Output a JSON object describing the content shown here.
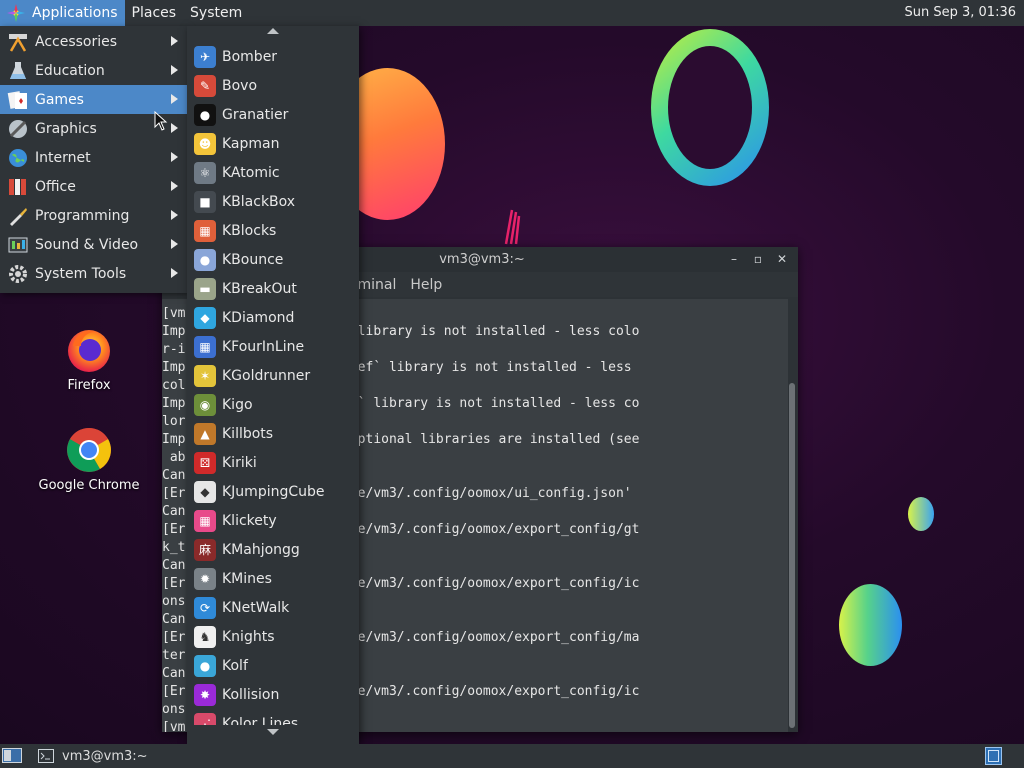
{
  "top_panel": {
    "menus": [
      {
        "label": "Applications",
        "icon": "applications-menu-icon",
        "active": true
      },
      {
        "label": "Places"
      },
      {
        "label": "System"
      }
    ],
    "clock": "Sun Sep  3, 01:36"
  },
  "desktop": {
    "icons": [
      {
        "label": "Firefox",
        "icon": "firefox-icon"
      },
      {
        "label": "Google Chrome",
        "icon": "chrome-icon"
      }
    ]
  },
  "apps_menu": {
    "categories": [
      {
        "label": "Accessories",
        "icon": "accessories-icon"
      },
      {
        "label": "Education",
        "icon": "education-icon"
      },
      {
        "label": "Games",
        "icon": "games-icon",
        "active": true
      },
      {
        "label": "Graphics",
        "icon": "graphics-icon"
      },
      {
        "label": "Internet",
        "icon": "internet-icon"
      },
      {
        "label": "Office",
        "icon": "office-icon"
      },
      {
        "label": "Programming",
        "icon": "programming-icon"
      },
      {
        "label": "Sound & Video",
        "icon": "sound-video-icon"
      },
      {
        "label": "System Tools",
        "icon": "system-tools-icon"
      }
    ]
  },
  "games_menu": {
    "items": [
      {
        "label": "Bomber",
        "color": "#3c7fd0",
        "glyph": "✈"
      },
      {
        "label": "Bovo",
        "color": "#d64a3a",
        "glyph": "✎"
      },
      {
        "label": "Granatier",
        "color": "#111111",
        "glyph": "●"
      },
      {
        "label": "Kapman",
        "color": "#f3c43a",
        "glyph": "☻"
      },
      {
        "label": "KAtomic",
        "color": "#6f7a85",
        "glyph": "⚛"
      },
      {
        "label": "KBlackBox",
        "color": "#444a50",
        "glyph": "■"
      },
      {
        "label": "KBlocks",
        "color": "#e0603a",
        "glyph": "▦"
      },
      {
        "label": "KBounce",
        "color": "#8aa6d8",
        "glyph": "●"
      },
      {
        "label": "KBreakOut",
        "color": "#9aa48a",
        "glyph": "▬"
      },
      {
        "label": "KDiamond",
        "color": "#2fa6e0",
        "glyph": "◆"
      },
      {
        "label": "KFourInLine",
        "color": "#3c6fd0",
        "glyph": "▦"
      },
      {
        "label": "KGoldrunner",
        "color": "#e3c43a",
        "glyph": "✶"
      },
      {
        "label": "Kigo",
        "color": "#6d8f3a",
        "glyph": "◉"
      },
      {
        "label": "Killbots",
        "color": "#c0782a",
        "glyph": "▲"
      },
      {
        "label": "Kiriki",
        "color": "#d02a2a",
        "glyph": "⚄"
      },
      {
        "label": "KJumpingCube",
        "color": "#e6e6e6",
        "glyph": "◆"
      },
      {
        "label": "Klickety",
        "color": "#e84a8a",
        "glyph": "▦"
      },
      {
        "label": "KMahjongg",
        "color": "#8a2a2a",
        "glyph": "麻"
      },
      {
        "label": "KMines",
        "color": "#7a8288",
        "glyph": "✹"
      },
      {
        "label": "KNetWalk",
        "color": "#2f8ad8",
        "glyph": "⟳"
      },
      {
        "label": "Knights",
        "color": "#f0f0f0",
        "glyph": "♞"
      },
      {
        "label": "Kolf",
        "color": "#3aa6d8",
        "glyph": "●"
      },
      {
        "label": "Kollision",
        "color": "#9a2ad8",
        "glyph": "✸"
      },
      {
        "label": "Kolor Lines",
        "color": "#d84a6a",
        "glyph": "⋰"
      }
    ]
  },
  "terminal": {
    "title": "vm3@vm3:~",
    "menu": [
      "rminal",
      "Help"
    ],
    "lines": [
      "[vm",
      "Imp     plugin: `colorz` library is not installed - less colo",
      "r-i    vailable.",
      "Imp     plugin: `colorthief` library is not installed - less",
      "col     available.",
      "Imp     plugin: `haishoku` library is not installed - less co",
      "lor    vailable.",
      "Imp     plugin: not all optional libraries are installed (see",
      " ab",
      "Can",
      "[Er    r directory: '/home/vm3/.config/oomox/ui_config.json'",
      "Can",
      "[Er    r directory: '/home/vm3/.config/oomox/export_config/gt",
      "k_t",
      "Can",
      "[Er    r directory: '/home/vm3/.config/oomox/export_config/ic",
      "ons",
      "Can",
      "[Er    r directory: '/home/vm3/.config/oomox/export_config/ma",
      "ter",
      "Can",
      "[Er    r directory: '/home/vm3/.config/oomox/export_config/ic",
      "ons",
      "[vm"
    ]
  },
  "bottom_panel": {
    "task_label": "vm3@vm3:~"
  }
}
